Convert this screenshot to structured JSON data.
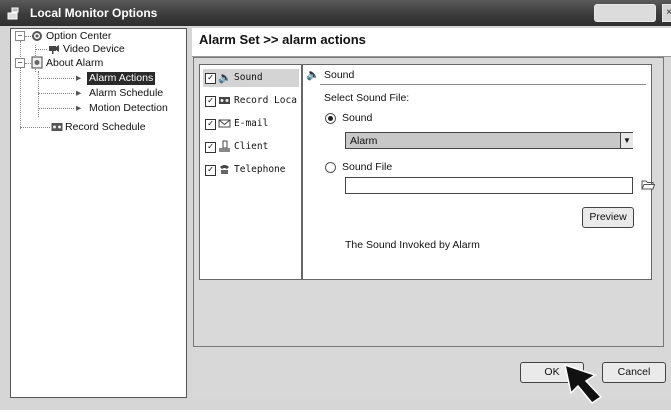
{
  "window": {
    "title": "Local Monitor Options"
  },
  "tree": {
    "items": [
      {
        "label": "Option Center",
        "icon": "gear-icon"
      },
      {
        "label": "Video Device",
        "icon": "camera-icon"
      },
      {
        "label": "About Alarm",
        "icon": "alarm-icon"
      },
      {
        "label": "Alarm Actions",
        "icon": "arrow-icon",
        "selected": true
      },
      {
        "label": "Alarm Schedule",
        "icon": "arrow-icon"
      },
      {
        "label": "Motion Detection",
        "icon": "arrow-icon"
      },
      {
        "label": "Record Schedule",
        "icon": "recorder-icon"
      }
    ]
  },
  "header": {
    "breadcrumb": "Alarm Set >> alarm actions"
  },
  "actions_list": [
    {
      "label": "Sound",
      "checked": true,
      "icon": "speaker-icon",
      "selected": true
    },
    {
      "label": "Record Loca",
      "checked": true,
      "icon": "recorder-icon"
    },
    {
      "label": "E-mail",
      "checked": true,
      "icon": "mail-icon"
    },
    {
      "label": "Client",
      "checked": true,
      "icon": "client-icon"
    },
    {
      "label": "Telephone",
      "checked": true,
      "icon": "telephone-icon"
    }
  ],
  "sound_panel": {
    "title": "Sound",
    "select_label": "Select Sound File:",
    "option_sound": "Sound",
    "sound_value": "Alarm",
    "option_sound_file": "Sound File",
    "file_path": "",
    "preview_label": "Preview",
    "note": "The Sound Invoked by Alarm"
  },
  "buttons": {
    "ok": "OK",
    "cancel": "Cancel"
  },
  "colors": {
    "titlebar": "#3c3c3c",
    "selection": "#2a2a2a",
    "background": "#d6d6d6"
  }
}
